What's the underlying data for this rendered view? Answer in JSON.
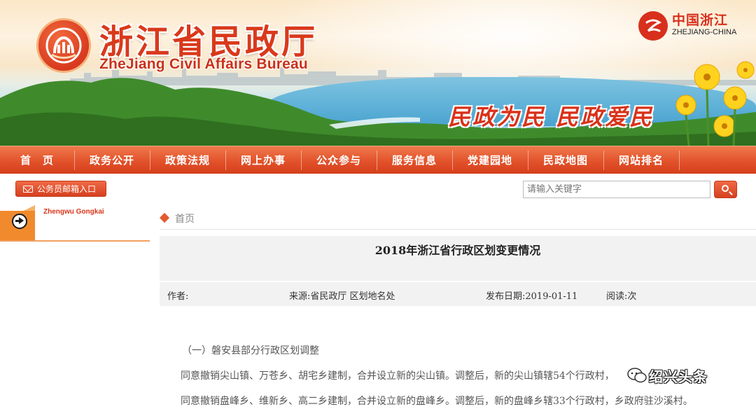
{
  "banner": {
    "title": "浙江省民政厅",
    "subtitle": "ZheJiang Civil Affairs Bureau",
    "slogan": "民政为民  民政爱民",
    "china_zj": {
      "cn": "中国浙江",
      "en": "ZHEJIANG-CHINA"
    }
  },
  "nav": {
    "items": [
      "首　页",
      "政务公开",
      "政策法规",
      "网上办事",
      "公众参与",
      "服务信息",
      "党建园地",
      "民政地图",
      "网站排名"
    ]
  },
  "mail_button": {
    "label": "公务员邮箱入口"
  },
  "search": {
    "placeholder": "请输入关键字"
  },
  "sidebar": {
    "title": "Zhengwu Gongkai"
  },
  "breadcrumb": {
    "home": "首页"
  },
  "article": {
    "title": "2018年浙江省行政区划变更情况",
    "meta": {
      "author": "作者:",
      "source": "来源:省民政厅 区划地名处",
      "date": "发布日期:2019-01-11",
      "reads": "阅读:次"
    },
    "paragraphs": [
      "（一）磐安县部分行政区划调整",
      "同意撤销尖山镇、万苍乡、胡宅乡建制，合并设立新的尖山镇。调整后，新的尖山镇辖54个行政村，",
      "同意撤销盘峰乡、维新乡、高二乡建制，合并设立新的盘峰乡。调整后，新的盘峰乡辖33个行政村，乡政府驻沙溪村。"
    ]
  },
  "watermark": {
    "text": "绍兴头条"
  },
  "colors": {
    "brand_red": "#d9391b",
    "nav_orange": "#e2522b"
  }
}
